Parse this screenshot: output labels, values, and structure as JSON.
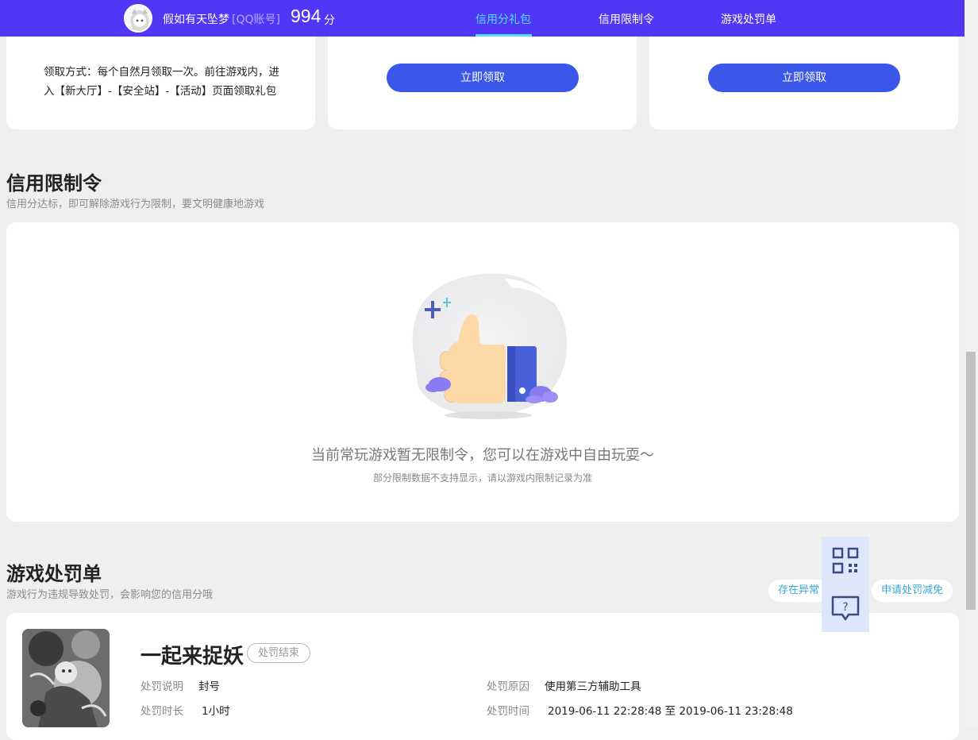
{
  "header": {
    "username": "假如有天坠梦",
    "account_type": "[QQ账号]",
    "score": "994",
    "score_unit": "分",
    "tabs": [
      {
        "label": "信用分礼包",
        "active": true
      },
      {
        "label": "信用限制令",
        "active": false
      },
      {
        "label": "游戏处罚单",
        "active": false
      }
    ]
  },
  "gift_cards": {
    "method_line1": "领取方式：每个自然月领取一次。前往游戏内，进",
    "method_line2": "入【新大厅】-【安全站】-【活动】页面领取礼包",
    "claim_button_1": "立即领取",
    "claim_button_2": "立即领取"
  },
  "restriction": {
    "title": "信用限制令",
    "subtitle": "信用分达标，即可解除游戏行为限制，要文明健康地游戏",
    "empty_message": "当前常玩游戏暂无限制令，您可以在游戏中自由玩耍～",
    "empty_note": "部分限制数据不支持显示，请以游戏内限制记录为准"
  },
  "punishment": {
    "title": "游戏处罚单",
    "subtitle": "游戏行为违规导致处罚，会影响您的信用分哦",
    "abnormal_pill": "存在异常",
    "appeal_pill": "申请处罚减免",
    "game_name": "一起来捉妖",
    "status": "处罚结束",
    "desc_label": "处罚说明",
    "desc_value": "封号",
    "duration_label": "处罚时长",
    "duration_value": "1小时",
    "reason_label": "处罚原因",
    "reason_value": "使用第三方辅助工具",
    "time_label": "处罚时间",
    "time_value": "2019-06-11 22:28:48 至 2019-06-11 23:28:48"
  },
  "floating": {
    "qr_icon": "qr-code-icon",
    "help_icon": "help-chat-icon"
  },
  "colors": {
    "header_bg": "#5236f5",
    "accent_cyan": "#4ee0ff",
    "button_blue": "#3b57e9",
    "link_blue": "#38a9d8"
  }
}
